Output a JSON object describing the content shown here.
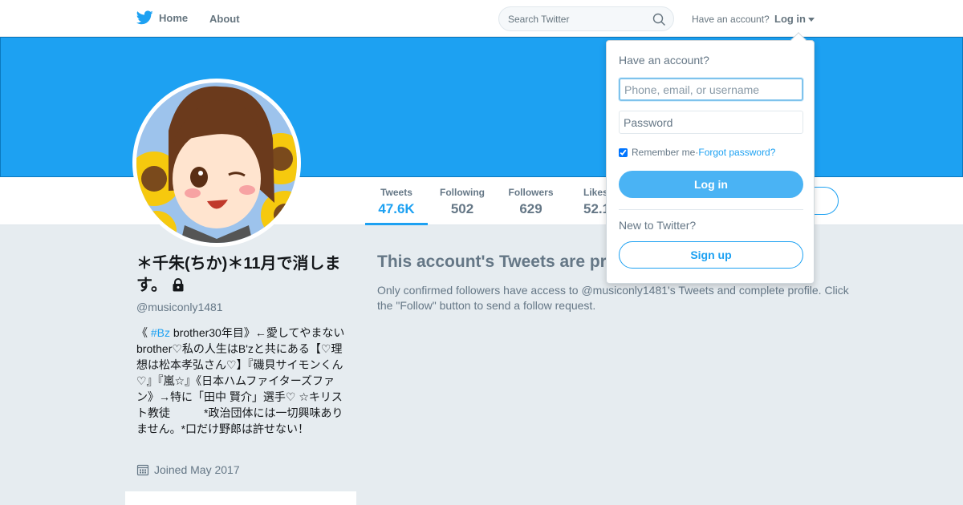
{
  "nav": {
    "home_label": "Home",
    "about_label": "About",
    "search_placeholder": "Search Twitter",
    "have_account": "Have an account?",
    "login_label": "Log in"
  },
  "profile": {
    "name": "＊千朱(ちか)＊11月で消します。",
    "screen_name": "@musiconly1481",
    "bio_before": "《 ",
    "bio_hashtag": "#Bz",
    "bio_after": " brother30年目》←愛してやまないbrother♡私の人生はB'zと共にある【♡理想は松本孝弘さん♡】『磯貝サイモンくん♡』『嵐☆』《日本ハムファイターズファン》→特に「田中 賢介」選手♡ ☆キリスト教徒　　　*政治団体には一切興味ありません。*口だけ野郎は許せない！",
    "joined": "Joined May 2017"
  },
  "stats": [
    {
      "label": "Tweets",
      "value": "47.6K"
    },
    {
      "label": "Following",
      "value": "502"
    },
    {
      "label": "Followers",
      "value": "629"
    },
    {
      "label": "Likes",
      "value": "52.1"
    }
  ],
  "protected": {
    "title": "This account's Tweets are pr",
    "text": "Only confirmed followers have access to @musiconly1481's Tweets and complete profile. Click the \"Follow\" button to send a follow request."
  },
  "login_dropdown": {
    "heading": "Have an account?",
    "username_placeholder": "Phone, email, or username",
    "password_placeholder": "Password",
    "remember_label": "Remember me",
    "separator": " · ",
    "forgot_label": "Forgot password?",
    "login_button": "Log in",
    "new_to_twitter": "New to Twitter?",
    "signup_button": "Sign up"
  },
  "colors": {
    "brand": "#1da1f2",
    "banner": "#1da1f2",
    "login_button": "#4ab3f4",
    "page_background": "#e6ecf0"
  }
}
